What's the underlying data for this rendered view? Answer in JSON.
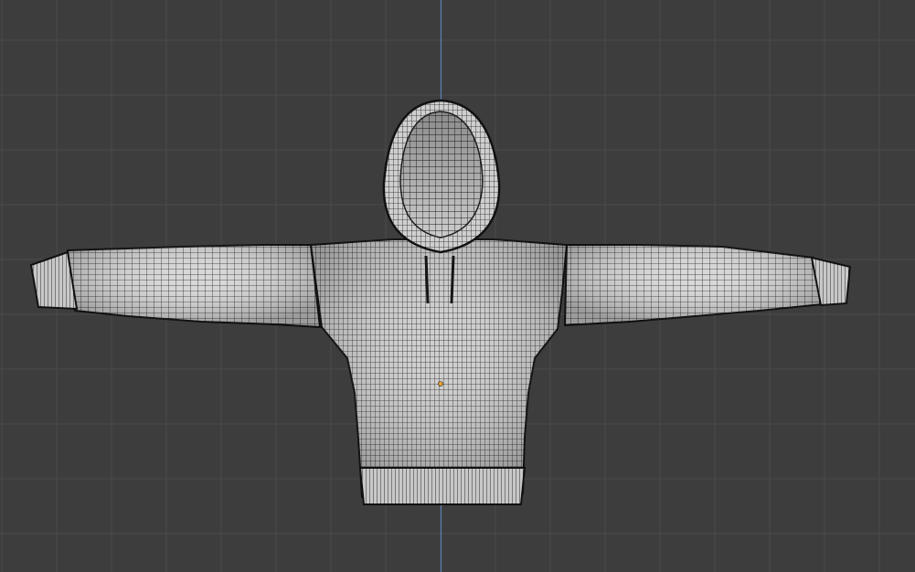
{
  "viewport": {
    "view": "front-orthographic",
    "background_color": "#3d3d3d",
    "grid_color": "#4a4a4a",
    "axis_color": "#5b7fb5"
  },
  "mesh": {
    "object": "hoodie-mesh",
    "display": "wireframe-over-solid",
    "surface_color": "#d9d9d9",
    "wire_color": "#1c1c1c"
  },
  "origin": {
    "color": "#f0a030"
  }
}
